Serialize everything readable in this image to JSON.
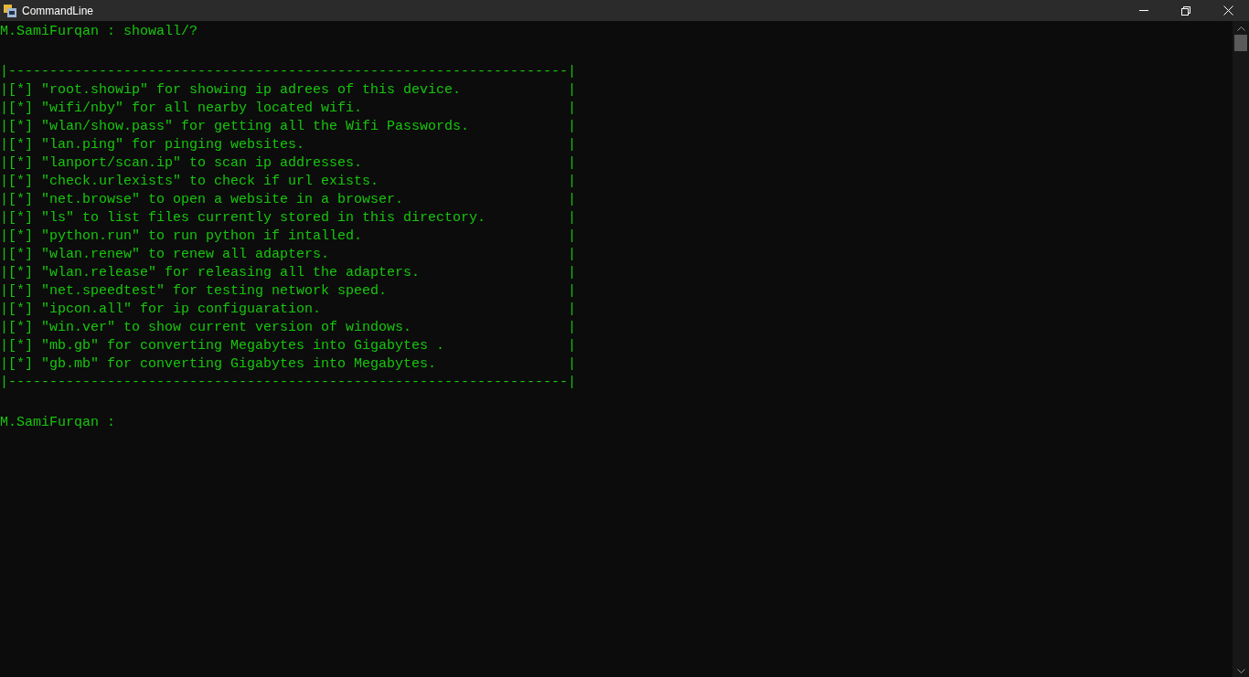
{
  "window": {
    "title": "CommandLine"
  },
  "console": {
    "command_line": "M.SamiFurqan : showall/?",
    "box_top": "|--------------------------------------------------------------------|",
    "rows": [
      {
        "text": "|[*] \"root.showip\" for showing ip adrees of this device.",
        "edge": "|"
      },
      {
        "text": "|[*] \"wifi/nby\" for all nearby located wifi.",
        "edge": "|"
      },
      {
        "text": "|[*] \"wlan/show.pass\" for getting all the Wifi Passwords.",
        "edge": "|"
      },
      {
        "text": "|[*] \"lan.ping\" for pinging websites.",
        "edge": "|"
      },
      {
        "text": "|[*] \"lanport/scan.ip\" to scan ip addresses.",
        "edge": "|"
      },
      {
        "text": "|[*] \"check.urlexists\" to check if url exists.",
        "edge": "|"
      },
      {
        "text": "|[*] \"net.browse\" to open a website in a browser.",
        "edge": "|"
      },
      {
        "text": "|[*] \"ls\" to list files currently stored in this directory.",
        "edge": "|"
      },
      {
        "text": "|[*] \"python.run\" to run python if intalled.",
        "edge": "|"
      },
      {
        "text": "|[*] \"wlan.renew\" to renew all adapters.",
        "edge": "|"
      },
      {
        "text": "|[*] \"wlan.release\" for releasing all the adapters.",
        "edge": "|"
      },
      {
        "text": "|[*] \"net.speedtest\" for testing network speed.",
        "edge": "|"
      },
      {
        "text": "|[*] \"ipcon.all\" for ip configuaration.",
        "edge": "|"
      },
      {
        "text": "|[*] \"win.ver\" to show current version of windows.",
        "edge": "|"
      },
      {
        "text": "|[*] \"mb.gb\" for converting Megabytes into Gigabytes .",
        "edge": "|"
      },
      {
        "text": "|[*] \"gb.mb\" for converting Gigabytes into Megabytes.",
        "edge": "|"
      }
    ],
    "box_bottom": "|--------------------------------------------------------------------|",
    "prompt": "M.SamiFurqan :"
  }
}
